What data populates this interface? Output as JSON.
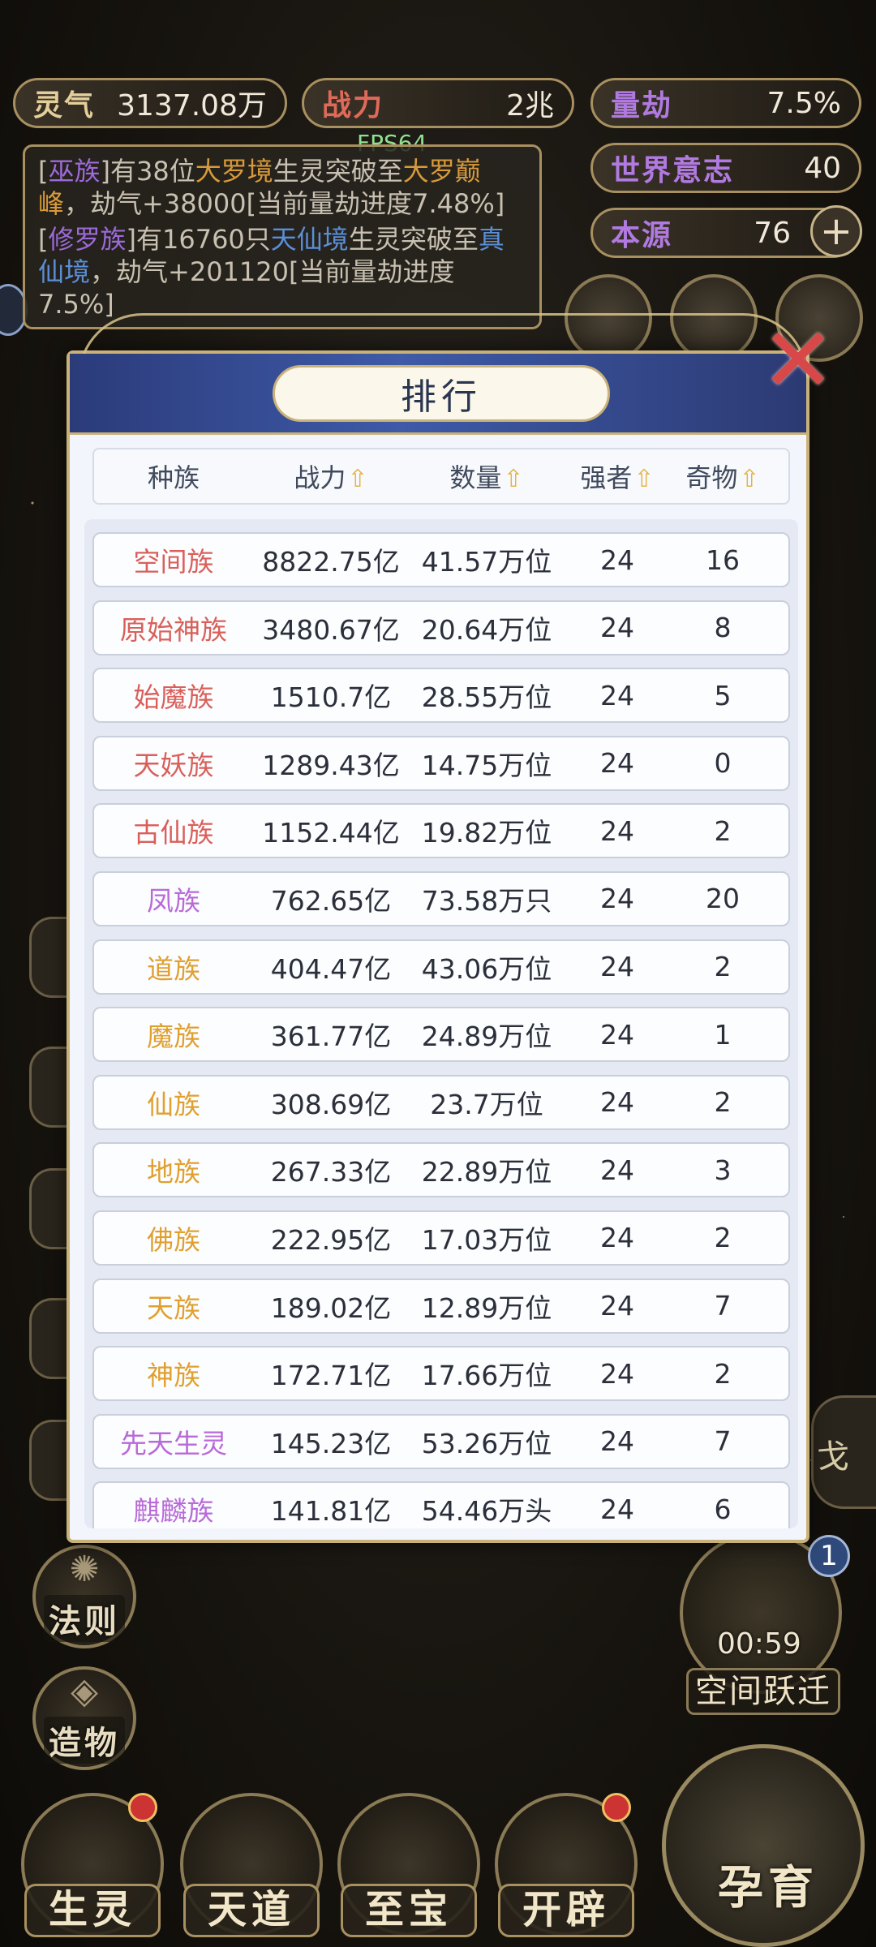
{
  "hud": {
    "spirit_label": "灵气",
    "spirit_value": "3137.08万",
    "power_label": "战力",
    "power_value": "2兆",
    "calamity_label": "量劫",
    "calamity_value": "7.5%",
    "world_will_label": "世界意志",
    "world_will_value": "40",
    "origin_label": "本源",
    "origin_value": "76",
    "plus_symbol": "+",
    "fps": "FPS64"
  },
  "log": {
    "line1_open": "[",
    "line1_race": "巫族",
    "line1_mid": "]有38位",
    "line1_realm": "大罗境",
    "line1_mid2": "生灵突破至",
    "line1_realm2": "大罗巅峰",
    "line1_tail": "，劫气+38000[当前量劫进度7.48%]",
    "line2_open": "[",
    "line2_race": "修罗族",
    "line2_mid": "]有16760只",
    "line2_realm": "天仙境",
    "line2_mid2": "生灵突破至",
    "line2_realm2": "真仙境",
    "line2_tail": "，劫气+201120[当前量劫进度7.5%]"
  },
  "modal": {
    "title": "排行",
    "close_icon": "close-x-icon",
    "headers": {
      "race": "种族",
      "power": "战力",
      "count": "数量",
      "strong": "强者",
      "treasure": "奇物",
      "sort_icon": "sort-arrow-icon"
    },
    "rows": [
      {
        "race": "空间族",
        "power": "8822.75亿",
        "count": "41.57万位",
        "strong": "24",
        "treasure": "16",
        "color": "#d9605a"
      },
      {
        "race": "原始神族",
        "power": "3480.67亿",
        "count": "20.64万位",
        "strong": "24",
        "treasure": "8",
        "color": "#d9605a"
      },
      {
        "race": "始魔族",
        "power": "1510.7亿",
        "count": "28.55万位",
        "strong": "24",
        "treasure": "5",
        "color": "#d9605a"
      },
      {
        "race": "天妖族",
        "power": "1289.43亿",
        "count": "14.75万位",
        "strong": "24",
        "treasure": "0",
        "color": "#d9605a"
      },
      {
        "race": "古仙族",
        "power": "1152.44亿",
        "count": "19.82万位",
        "strong": "24",
        "treasure": "2",
        "color": "#d9605a"
      },
      {
        "race": "凤族",
        "power": "762.65亿",
        "count": "73.58万只",
        "strong": "24",
        "treasure": "20",
        "color": "#b86ad8"
      },
      {
        "race": "道族",
        "power": "404.47亿",
        "count": "43.06万位",
        "strong": "24",
        "treasure": "2",
        "color": "#e0a030"
      },
      {
        "race": "魔族",
        "power": "361.77亿",
        "count": "24.89万位",
        "strong": "24",
        "treasure": "1",
        "color": "#e0a030"
      },
      {
        "race": "仙族",
        "power": "308.69亿",
        "count": "23.7万位",
        "strong": "24",
        "treasure": "2",
        "color": "#e0a030"
      },
      {
        "race": "地族",
        "power": "267.33亿",
        "count": "22.89万位",
        "strong": "24",
        "treasure": "3",
        "color": "#e0a030"
      },
      {
        "race": "佛族",
        "power": "222.95亿",
        "count": "17.03万位",
        "strong": "24",
        "treasure": "2",
        "color": "#e0a030"
      },
      {
        "race": "天族",
        "power": "189.02亿",
        "count": "12.89万位",
        "strong": "24",
        "treasure": "7",
        "color": "#e0a030"
      },
      {
        "race": "神族",
        "power": "172.71亿",
        "count": "17.66万位",
        "strong": "24",
        "treasure": "2",
        "color": "#e0a030"
      },
      {
        "race": "先天生灵",
        "power": "145.23亿",
        "count": "53.26万位",
        "strong": "24",
        "treasure": "7",
        "color": "#b86ad8"
      },
      {
        "race": "麒麟族",
        "power": "141.81亿",
        "count": "54.46万头",
        "strong": "24",
        "treasure": "6",
        "color": "#b86ad8"
      }
    ]
  },
  "side": {
    "law_label": "法则",
    "create_label": "造物"
  },
  "jump": {
    "badge": "1",
    "timer": "00:59",
    "label": "空间跃迁"
  },
  "nav": {
    "items": [
      "生灵",
      "天道",
      "至宝",
      "开辟"
    ],
    "nurture": "孕育"
  }
}
